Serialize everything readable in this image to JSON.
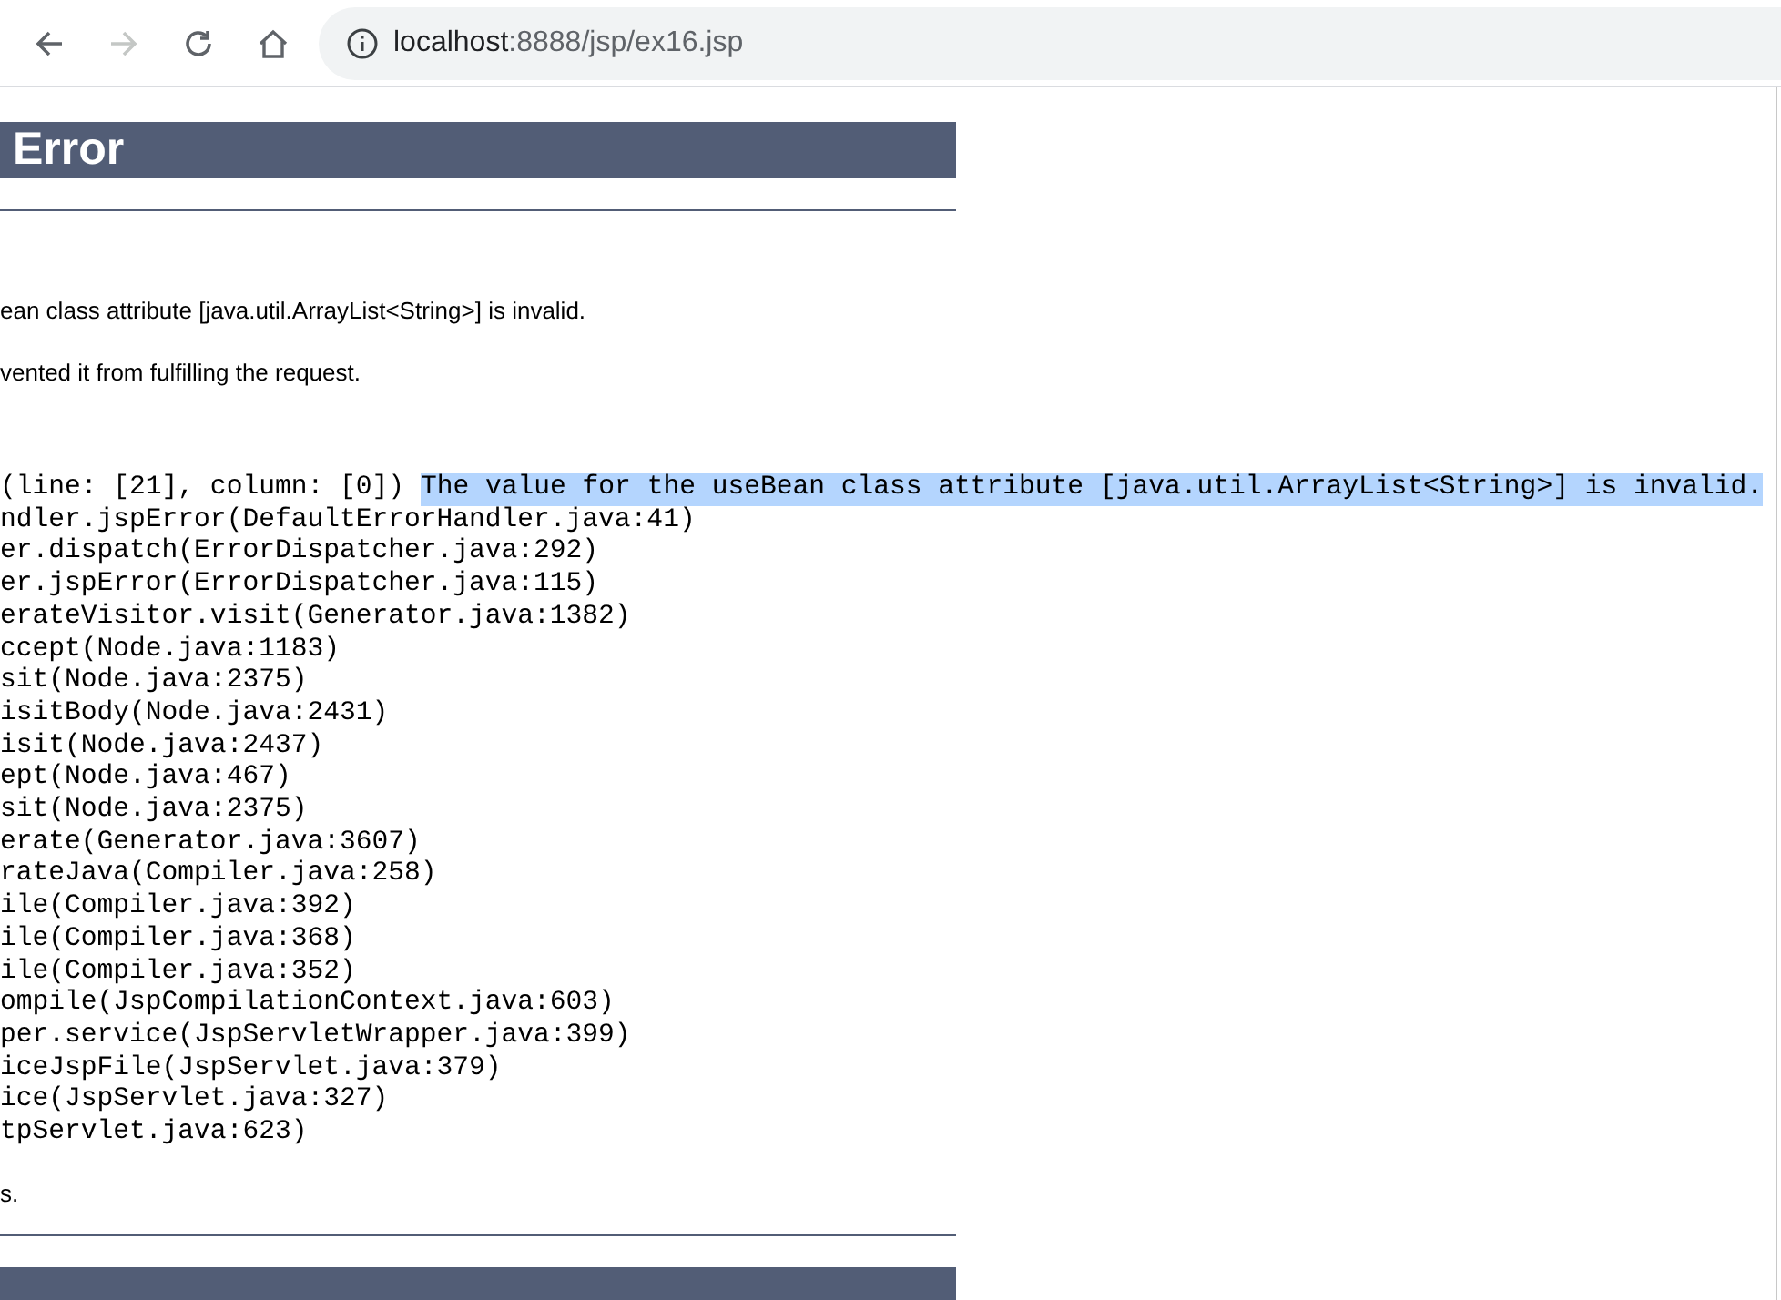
{
  "toolbar": {
    "back_enabled": true,
    "forward_enabled": false,
    "url_host": "localhost",
    "url_rest": ":8888/jsp/ex16.jsp"
  },
  "page": {
    "heading": "Error",
    "message": "ean class attribute [java.util.ArrayList<String>] is invalid.",
    "description": "vented it from fulfilling the request.",
    "trace_first": {
      "text": "(line: [21], column: [0])",
      "selected_text": "The value for the useBean class attribute [java.util.ArrayList<String>] is invalid."
    },
    "trace_lines": [
      "ndler.jspError(DefaultErrorHandler.java:41)",
      "er.dispatch(ErrorDispatcher.java:292)",
      "er.jspError(ErrorDispatcher.java:115)",
      "erateVisitor.visit(Generator.java:1382)",
      "ccept(Node.java:1183)",
      "sit(Node.java:2375)",
      "isitBody(Node.java:2431)",
      "isit(Node.java:2437)",
      "ept(Node.java:467)",
      "sit(Node.java:2375)",
      "erate(Generator.java:3607)",
      "rateJava(Compiler.java:258)",
      "ile(Compiler.java:392)",
      "ile(Compiler.java:368)",
      "ile(Compiler.java:352)",
      "ompile(JspCompilationContext.java:603)",
      "per.service(JspServletWrapper.java:399)",
      "iceJspFile(JspServlet.java:379)",
      "ice(JspServlet.java:327)",
      "tpServlet.java:623)"
    ],
    "note": "s."
  }
}
